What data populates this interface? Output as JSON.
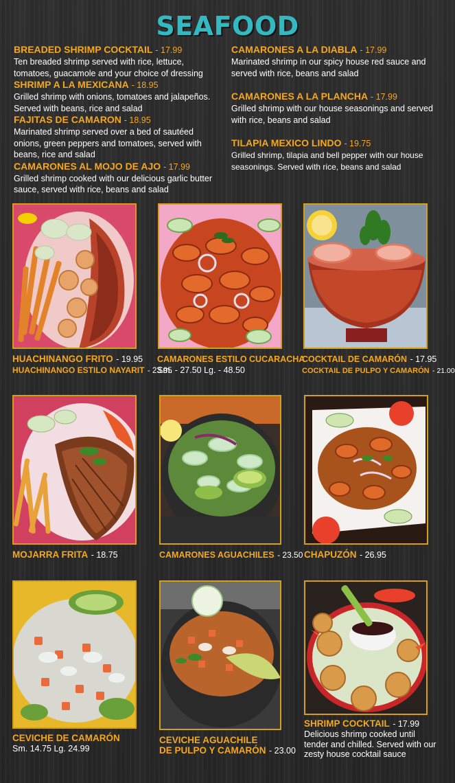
{
  "title": "SEAFOOD",
  "left_items": [
    {
      "name": "BREADED SHRIMP COCKTAIL",
      "price": "- 17.99",
      "desc": "Ten breaded shrimp served with rice, lettuce, tomatoes, guacamole and your choice of dressing"
    },
    {
      "name": "SHRIMP A LA MEXICANA",
      "price": "- 18.95",
      "desc": "Grilled shrimp with onions, tomatoes and jalapeños.  Served with beans, rice and salad"
    },
    {
      "name": "FAJITAS DE CAMARON",
      "price": "- 18.95",
      "desc": "Marinated shrimp served over a bed of sautéed onions, green peppers and tomatoes, served with beans, rice and salad"
    },
    {
      "name": "CAMARONES AL MOJO DE AJO",
      "price": "- 17.99",
      "desc": "Grilled shrimp cooked with our delicious garlic butter sauce, served with rice, beans and salad"
    }
  ],
  "right_items": [
    {
      "name": "CAMARONES A LA DIABLA",
      "price": "- 17.99",
      "desc": "Marinated shrimp in our spicy house red sauce and served with rice, beans and salad"
    },
    {
      "name": "CAMARONES A LA PLANCHA",
      "price": "- 17.99",
      "desc": "Grilled shrimp with our house seasonings and served with rice, beans and salad"
    },
    {
      "name": "TILAPIA MEXICO LINDO",
      "price": "- 19.75",
      "desc": "Grilled shrimp, tilapia and bell pepper with our house seasonings.  Served with rice, beans and salad"
    }
  ],
  "dishes": [
    {
      "line1_name": "HUACHINANGO FRITO",
      "line1_price": "- 19.95",
      "line2_name": "HUACHINANGO ESTILO NAYARIT",
      "line2_price": "- 23.95"
    },
    {
      "line1_name": "CAMARONES ESTILO CUCARACHA",
      "line2_plain": "Sm. - 27.50  Lg. - 48.50"
    },
    {
      "line1_name": "COCKTAIL DE CAMARÓN",
      "line1_price": "- 17.95",
      "line2_name": "COCKTAIL DE PULPO Y CAMARÓN",
      "line2_price": "- 21.00"
    },
    {
      "line1_name": "MOJARRA FRITA",
      "line1_price": "- 18.75"
    },
    {
      "line1_name": "CAMARONES AGUACHILES",
      "line1_price": "- 23.50"
    },
    {
      "line1_name": "CHAPUZÓN",
      "line1_price": "- 26.95"
    },
    {
      "line1_name": "CEVICHE DE CAMARÓN",
      "line2_plain": "Sm. 14.75  Lg. 24.99"
    },
    {
      "line1_name": "CEVICHE AGUACHILE",
      "line2_name": "DE PULPO Y CAMARÓN",
      "line2_price": "- 23.00"
    },
    {
      "line1_name": "SHRIMP COCKTAIL",
      "line1_price": "- 17.99",
      "desc": "Delicious shrimp cooked until tender and chilled.  Served with our zesty house cocktail sauce"
    }
  ],
  "colors": {
    "title": "#33b9c1",
    "accent": "#f4a81d",
    "frame": "#d4a017",
    "background": "#2a2a2a"
  }
}
